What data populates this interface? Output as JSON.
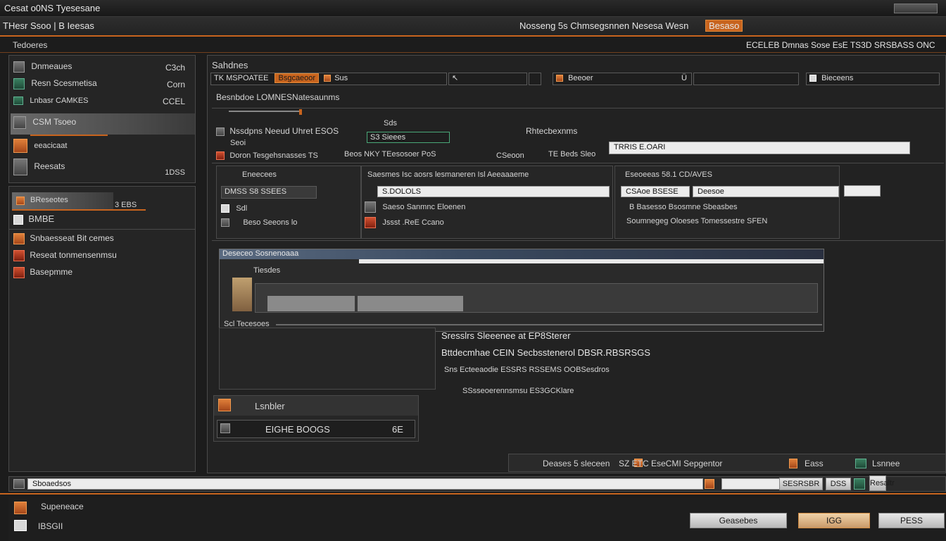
{
  "window": {
    "title": "Cesat o0NS Tyesesane"
  },
  "menubar": {
    "left": "THesr  Ssoo  |  B  Ieesas",
    "center": "Nosseng  5s  Chmsegsnnen  Nesesa  Wesn",
    "badge": "Besaso"
  },
  "right_header": "ECELEB  Dmnas  Sose  EsE  TS3D  SRSBASS  ONC",
  "left_panel": {
    "title": "Tedoeres",
    "items": [
      {
        "label": "Dnmeaues",
        "value": "C3ch"
      },
      {
        "label": "Resn  Scesmetisa",
        "value": "Corn"
      },
      {
        "label": "Lnbasr  CAMKES",
        "value": "CCEL"
      },
      {
        "label": "CSM  Tsoeo",
        "value": ""
      },
      {
        "label": "eeacicaat",
        "value": ""
      },
      {
        "label": "Reesats",
        "value": "1DSS"
      }
    ]
  },
  "left_panel2": {
    "header": "BReseotes",
    "header_side": "3  EBS",
    "title": "BMBE",
    "items": [
      {
        "label": "Snbaesseat  Bit  cemes"
      },
      {
        "label": "Reseat  tonmensenmsu"
      },
      {
        "label": "Basepmme"
      }
    ]
  },
  "main": {
    "section_title": "Sahdnes",
    "toolbar": {
      "label": "TK  MSPOATEE",
      "badge": "Bsgcaeoor",
      "seg2": "Sus",
      "seg3": "Beeoer",
      "seg4": "Bieceens"
    },
    "sub_title": "Besnbdoe  LOMNESNatesaunms",
    "row1": {
      "label": "Nssdpns  Neeud  Uhret  ESOS",
      "mid": "S3  Sieees",
      "right": "Rhtecbexnms"
    },
    "row1b": {
      "label": "Seoi",
      "mid": "Sds",
      "input": "TRRIS  E.OARI"
    },
    "row1c": {
      "label": "Doron  Tesgehsnasses  TS",
      "mid": "Beos  NKY  TEesosoer  PoS",
      "mid2": "CSeoon",
      "mid3": "TE  Beds  Sleo"
    },
    "col1": {
      "title": "Eneecees",
      "tab": "DMSS  S8  SSEES",
      "row2": "Sdl",
      "row3": "Beso  Seeons  lo"
    },
    "col2": {
      "title": "Saesmes  Isc  aosrs  lesmaneren  Isl  Aeeaaaeme",
      "input": "S.DOLOLS",
      "row2": "Saeso  Sanmnc  Eloenen",
      "row3": "Jssst  .ReE  Ccano"
    },
    "col3": {
      "title": "Eseoeeas  58.1  CD/AVES",
      "field1": "CSAoe  BSESE",
      "field2": "Deesoe",
      "row2": "B  Basesso  Bsosmne  Sbeasbes",
      "row3": "Soumnegeg  Oloeses  Tomessestre  SFEN"
    }
  },
  "dialog": {
    "title": "Deseceo  Sosnenoaaa",
    "label": "Tiesdes",
    "label2": "Scl  Tecesoes"
  },
  "info": {
    "line1": "Sresslrs  Sleeenee  at  EP8Sterer",
    "line2": "Bttdecmhae  CEIN  Secbsstenerol  DBSR.RBSRSGS",
    "line3": "Sns  Ecteeaodie  ESSRS  RSSEMS  OOBSesdros",
    "line4": "SSsseoerennsmsu  ES3GCKlare"
  },
  "subpanel": {
    "title": "Lsnbler",
    "row": "EIGHE  BOOGS",
    "value": "6E"
  },
  "statusbar": {
    "left": "Deases  5  sleceen",
    "mid": "SZ  ETC  EseCMI  Sepgentor",
    "r1": "Eass",
    "r2": "Lsnnee"
  },
  "path": {
    "label": "Sboaedsos",
    "btn1": "SESRSBR",
    "btn2": "DSS",
    "btn3": "Resaltr"
  },
  "bottom": {
    "item1": "Supeneace",
    "item2": "IBSGII",
    "buttons": {
      "cancel": "Geasebes",
      "ok": "IGG",
      "help": "PESS"
    }
  }
}
